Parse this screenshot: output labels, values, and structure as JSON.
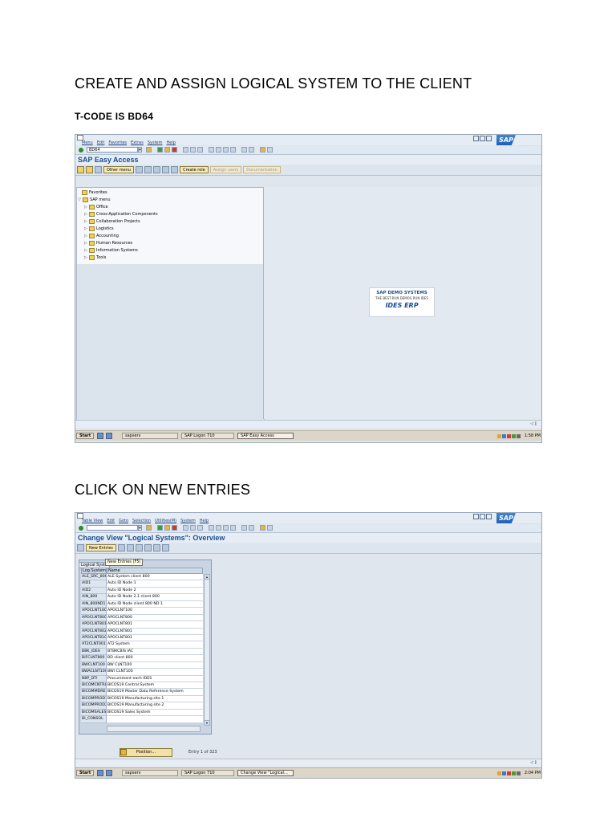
{
  "doc": {
    "heading1": "CREATE AND ASSIGN LOGICAL SYSTEM TO THE CLIENT",
    "heading2": "T-CODE IS BD64",
    "heading3": "CLICK ON NEW ENTRIES"
  },
  "colors": {
    "sap_blue": "#1a4d8f",
    "folder_yellow": "#f1d24f",
    "window_bg": "#dfe6ee"
  },
  "screen1": {
    "menu": [
      "Menu",
      "Edit",
      "Favorites",
      "Extras",
      "System",
      "Help"
    ],
    "command_value": "BD64",
    "title": "SAP Easy Access",
    "toolbar": {
      "other_menu": "Other menu",
      "create_role": "Create role",
      "assign_users": "Assign users",
      "documentation": "Documentation"
    },
    "tree": {
      "favorites": "Favorites",
      "sap_menu": "SAP menu",
      "items": [
        "Office",
        "Cross-Application Components",
        "Collaboration Projects",
        "Logistics",
        "Accounting",
        "Human Resources",
        "Information Systems",
        "Tools"
      ]
    },
    "logo": {
      "line1": "SAP DEMO SYSTEMS",
      "line2": "THE BEST-RUN DEMOS RUN IDES",
      "line3": "IDES ERP"
    },
    "taskbar": {
      "start": "Start",
      "items": [
        "sapserv",
        "SAP Logon 710",
        "SAP Easy Access"
      ],
      "clock": "1:58 PM"
    }
  },
  "screen2": {
    "menu": [
      "Table View",
      "Edit",
      "Goto",
      "Selection",
      "Utilities(M)",
      "System",
      "Help"
    ],
    "title": "Change View \"Logical Systems\": Overview",
    "toolbar": {
      "new_entries": "New Entries"
    },
    "table_label": "Logical Syste",
    "tooltip": "New Entries  (F5)",
    "columns": [
      "Log.System",
      "Name"
    ],
    "rows": [
      [
        "ALE_SRC_800",
        "ALE System client 800"
      ],
      [
        "AID1",
        "Auto ID Node 1"
      ],
      [
        "AID2",
        "Auto ID Node 2"
      ],
      [
        "AIN_800",
        "Auto ID Node 2.1 client 800"
      ],
      [
        "AIN_800ND1",
        "Auto ID Node client 800 ND 1"
      ],
      [
        "APOCLNT100",
        "APOCLNT100"
      ],
      [
        "APOCLNT800",
        "APOCLNT800"
      ],
      [
        "APOCLNT801",
        "APOCLNT801"
      ],
      [
        "APOCLNT802",
        "APOCLNT801"
      ],
      [
        "APOCLNT810",
        "APOCLNT801"
      ],
      [
        "AT2CLNT001",
        "AT2 System"
      ],
      [
        "BBK_IDES",
        "BTBKCBIS IAC"
      ],
      [
        "BIFCLNT800",
        "BD client 800"
      ],
      [
        "BWCLNT100",
        "BW CLNT100"
      ],
      [
        "BWACLNT100",
        "BWI CLNT100"
      ],
      [
        "BBP_DTI",
        "Procurement each IDES"
      ],
      [
        "BICOMCNTRL",
        "BICOS19 Central System"
      ],
      [
        "BICOMMDREF",
        "BICOS19 Master Data Reference System"
      ],
      [
        "BICOMPROD1",
        "BICOS19 Manufacturing site 1"
      ],
      [
        "BICOMPROD2",
        "BICOS19 Manufacturing site 2"
      ],
      [
        "BICOMSALES",
        "BICOS19 Sales System"
      ],
      [
        "BI_CONSOL",
        ""
      ]
    ],
    "position_button": "Position...",
    "entry_count": "Entry 1 of 323",
    "taskbar": {
      "start": "Start",
      "items": [
        "sapserv",
        "SAP Logon 710",
        "Change View \"Logical..."
      ],
      "clock": "2:04 PM"
    }
  }
}
